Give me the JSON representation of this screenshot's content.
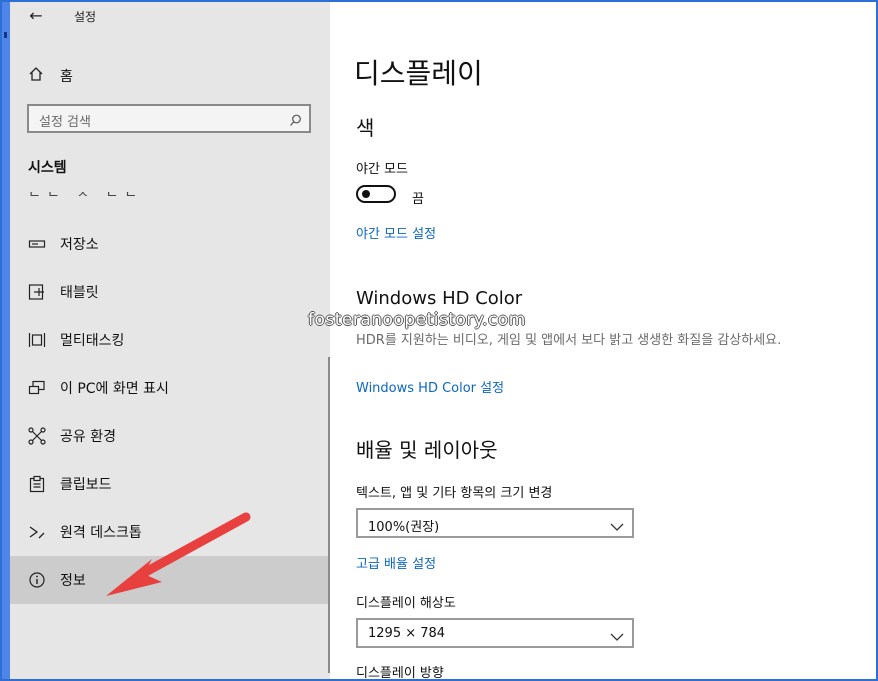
{
  "window": {
    "title": "설정",
    "back_glyph": "←"
  },
  "sidebar": {
    "home_label": "홈",
    "search_placeholder": "설정 검색",
    "section_title": "시스템",
    "cut_item_label": "ㄴㄴ ㅈ ㄴㄴ",
    "items": [
      {
        "label": "저장소",
        "icon": "storage-icon"
      },
      {
        "label": "태블릿",
        "icon": "tablet-icon"
      },
      {
        "label": "멀티태스킹",
        "icon": "multitasking-icon"
      },
      {
        "label": "이 PC에 화면 표시",
        "icon": "project-to-pc-icon"
      },
      {
        "label": "공유 환경",
        "icon": "shared-experiences-icon"
      },
      {
        "label": "클립보드",
        "icon": "clipboard-icon"
      },
      {
        "label": "원격 데스크톱",
        "icon": "remote-desktop-icon"
      },
      {
        "label": "정보",
        "icon": "info-icon",
        "selected": true
      }
    ]
  },
  "main": {
    "page_title": "디스플레이",
    "color_section": "색",
    "night_mode_label": "야간 모드",
    "night_mode_state": "끔",
    "night_mode_on": false,
    "night_mode_settings_link": "야간 모드 설정",
    "hd_color_title": "Windows HD Color",
    "hd_color_desc": "HDR를 지원하는 비디오, 게임 및 앱에서 보다 밝고 생생한 화질을 감상하세요.",
    "hd_color_link": "Windows HD Color 설정",
    "scale_section": "배율 및 레이아웃",
    "text_size_label": "텍스트, 앱 및 기타 항목의 크기 변경",
    "text_size_value": "100%(권장)",
    "advanced_scaling_link": "고급 배율 설정",
    "resolution_label": "디스플레이 해상도",
    "resolution_value": "1295 × 784",
    "orientation_label": "디스플레이 방향"
  },
  "annotations": {
    "watermark": "fosteranoopetistory.com",
    "arrow_color": "#e8403f"
  },
  "colors": {
    "sidebar_bg": "#e6e6e6",
    "selected_bg": "#cccccc",
    "link": "#0b67c2",
    "frame_border": "#2e6fd6"
  }
}
